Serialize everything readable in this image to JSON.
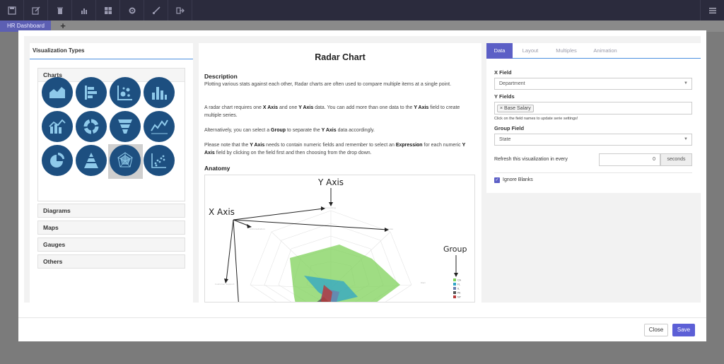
{
  "toolbar": {
    "icons": [
      "save-icon",
      "edit-icon",
      "trash-icon",
      "bar-chart-icon",
      "dashboard-icon",
      "gear-icon",
      "brush-icon",
      "logout-icon",
      "menu-icon"
    ]
  },
  "tabs": {
    "dashboard_label": "HR Dashboard",
    "add_label": "+"
  },
  "left": {
    "title": "Visualization Types",
    "charts_label": "Charts",
    "categories": [
      "Diagrams",
      "Maps",
      "Gauges",
      "Others"
    ]
  },
  "middle": {
    "title": "Radar Chart",
    "description_heading": "Description",
    "anatomy_heading": "Anatomy",
    "p1": "Plotting various stats against each other, Radar charts are often used to compare multiple items at a single point.",
    "p2_a": "A radar chart requires one ",
    "p2_b": "X Axis",
    "p2_c": " and one ",
    "p2_d": "Y Axis",
    "p2_e": " data. You can add more than one data to the ",
    "p2_f": "Y Axis",
    "p2_g": " field to create multiple series.",
    "p3_a": "Alternatively, you can select a ",
    "p3_b": "Group",
    "p3_c": " to separate the ",
    "p3_d": "Y Axis",
    "p3_e": " data accordingly.",
    "p4_a": "Please note that the ",
    "p4_b": "Y Axis",
    "p4_c": " needs to contain numeric fields and remember to select an ",
    "p4_d": "Expression",
    "p4_e": " for each numeric ",
    "p4_f": "Y Axis",
    "p4_g": " field by clicking on the field first and then choosing from the drop down.",
    "anatomy": {
      "y_axis_label": "Y Axis",
      "x_axis_label": "X Axis",
      "group_label": "Group",
      "legend": [
        {
          "name": "CA",
          "color": "#7fd15a"
        },
        {
          "name": "FL",
          "color": "#2fa4c7"
        },
        {
          "name": "IL",
          "color": "#6a7fb0"
        },
        {
          "name": "PA",
          "color": "#555555"
        },
        {
          "name": "NY",
          "color": "#b83a3a"
        }
      ]
    }
  },
  "right": {
    "tabs": [
      "Data",
      "Layout",
      "Multiples",
      "Animation"
    ],
    "x_field_label": "X Field",
    "x_field_value": "Department",
    "y_fields_label": "Y Fields",
    "y_field_chip": "Base Salary",
    "y_hint": "Click on the field names to update serie settings!",
    "group_field_label": "Group Field",
    "group_field_value": "State",
    "refresh_label": "Refresh this visualization in every",
    "refresh_value": "0",
    "refresh_unit": "seconds",
    "ignore_blanks_label": "Ignore Blanks"
  },
  "footer": {
    "close_label": "Close",
    "save_label": "Save"
  },
  "colors": {
    "accent": "#5c5fd6",
    "icon_bg": "#1d4f80",
    "toolbar": "#2b2b3d"
  }
}
